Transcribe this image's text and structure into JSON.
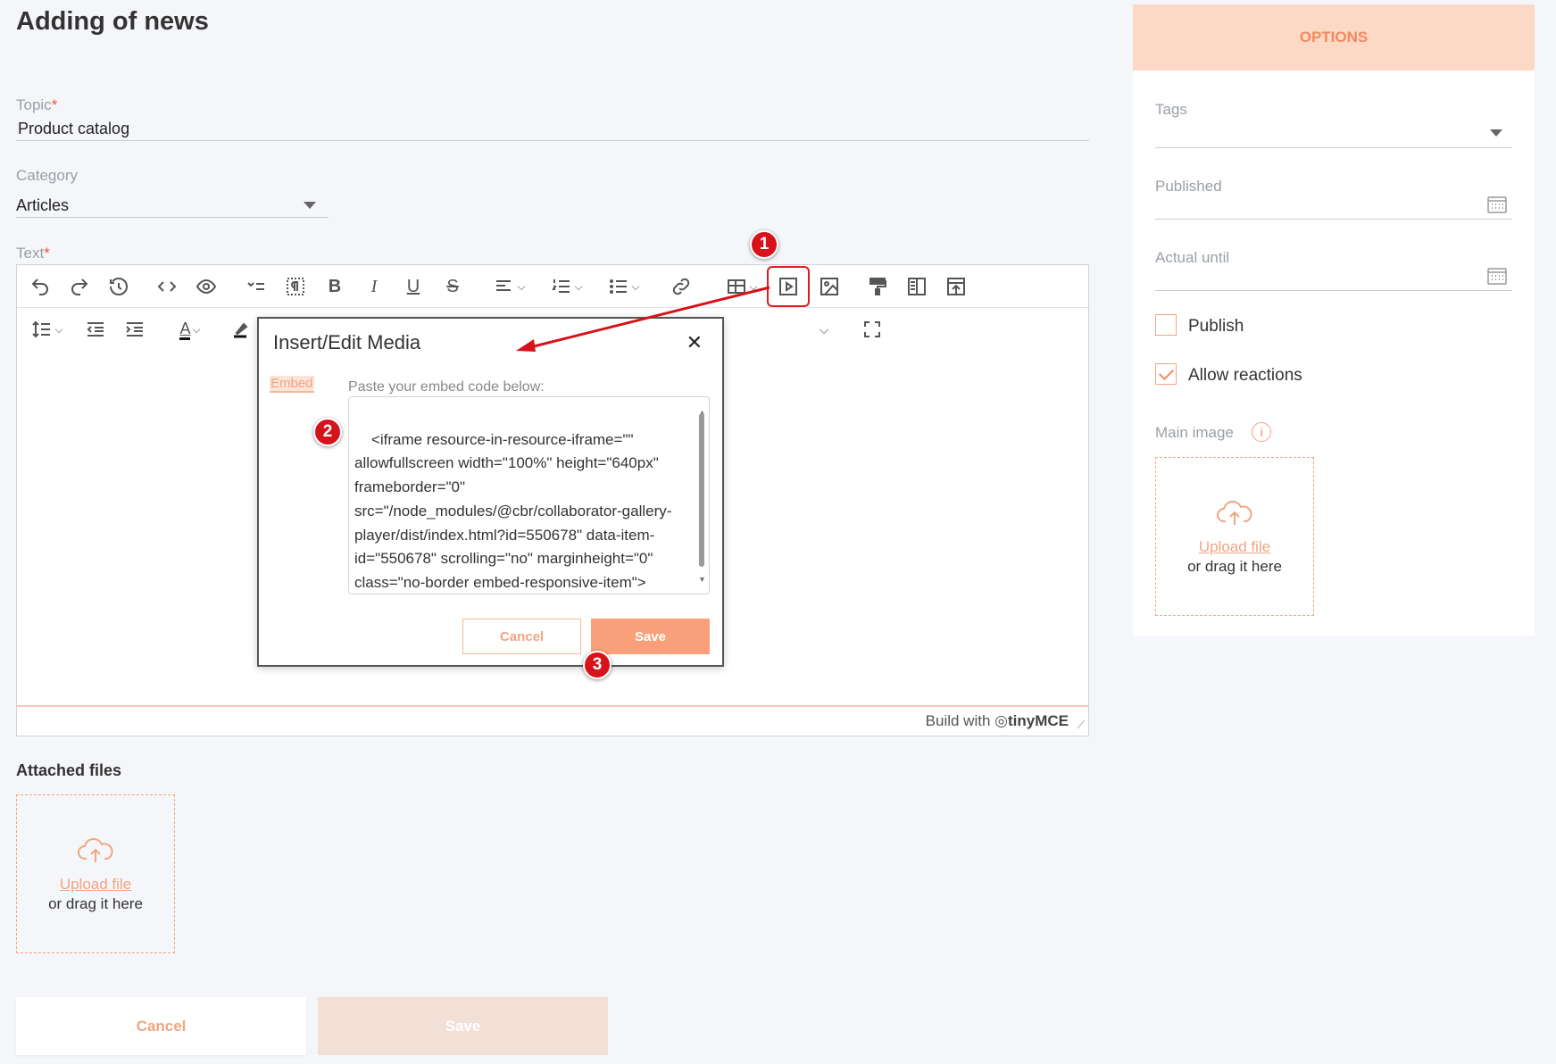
{
  "page": {
    "title": "Adding of news"
  },
  "form": {
    "topic": {
      "label": "Topic",
      "required_mark": "*",
      "value": "Product catalog"
    },
    "category": {
      "label": "Category",
      "value": "Articles"
    },
    "text": {
      "label": "Text",
      "required_mark": "*"
    }
  },
  "editor": {
    "status_prefix": "Build with",
    "brand": "tinyMCE",
    "toolbar1": [
      "undo-icon",
      "redo-icon",
      "history-icon",
      "code-icon",
      "preview-icon",
      "list-style-icon",
      "paragraph-marks-icon",
      "bold-icon",
      "italic-icon",
      "underline-icon",
      "strikethrough-icon",
      "align-icon",
      "numbered-list-icon",
      "bullet-list-icon",
      "link-icon",
      "table-icon",
      "media-icon",
      "image-icon",
      "format-painter-icon",
      "template-icon",
      "export-icon"
    ],
    "toolbar2": [
      "line-height-icon",
      "outdent-icon",
      "indent-icon",
      "text-color-icon",
      "highlight-icon",
      "fullscreen-icon"
    ]
  },
  "modal": {
    "title": "Insert/Edit Media",
    "close_glyph": "✕",
    "tab": "Embed",
    "paste_label": "Paste your embed code below:",
    "code": "<iframe resource-in-resource-iframe=\"\" allowfullscreen width=\"100%\" height=\"640px\" frameborder=\"0\" src=\"/node_modules/@cbr/collaborator-gallery-player/dist/index.html?id=550678\" data-item-id=\"550678\" scrolling=\"no\" marginheight=\"0\" class=\"no-border embed-responsive-item\"></iframe>|",
    "cancel": "Cancel",
    "save": "Save"
  },
  "annotations": {
    "step1": "1",
    "step2": "2",
    "step3": "3",
    "color": "#d6121a"
  },
  "attachments": {
    "title": "Attached files",
    "upload_link": "Upload file",
    "hint": "or drag it here"
  },
  "actions": {
    "cancel": "Cancel",
    "save": "Save"
  },
  "options": {
    "header": "OPTIONS",
    "tags": {
      "label": "Tags"
    },
    "published": {
      "label": "Published"
    },
    "actual_until": {
      "label": "Actual until"
    },
    "publish": {
      "label": "Publish",
      "checked": false
    },
    "allow_reactions": {
      "label": "Allow reactions",
      "checked": true
    },
    "main_image": {
      "label": "Main image",
      "info_glyph": "i",
      "upload_link": "Upload file",
      "hint": "or drag it here"
    }
  },
  "colors": {
    "accent": "#f28a5e",
    "accent_light": "#fcd9c5",
    "annotation_red": "#d6121a"
  }
}
